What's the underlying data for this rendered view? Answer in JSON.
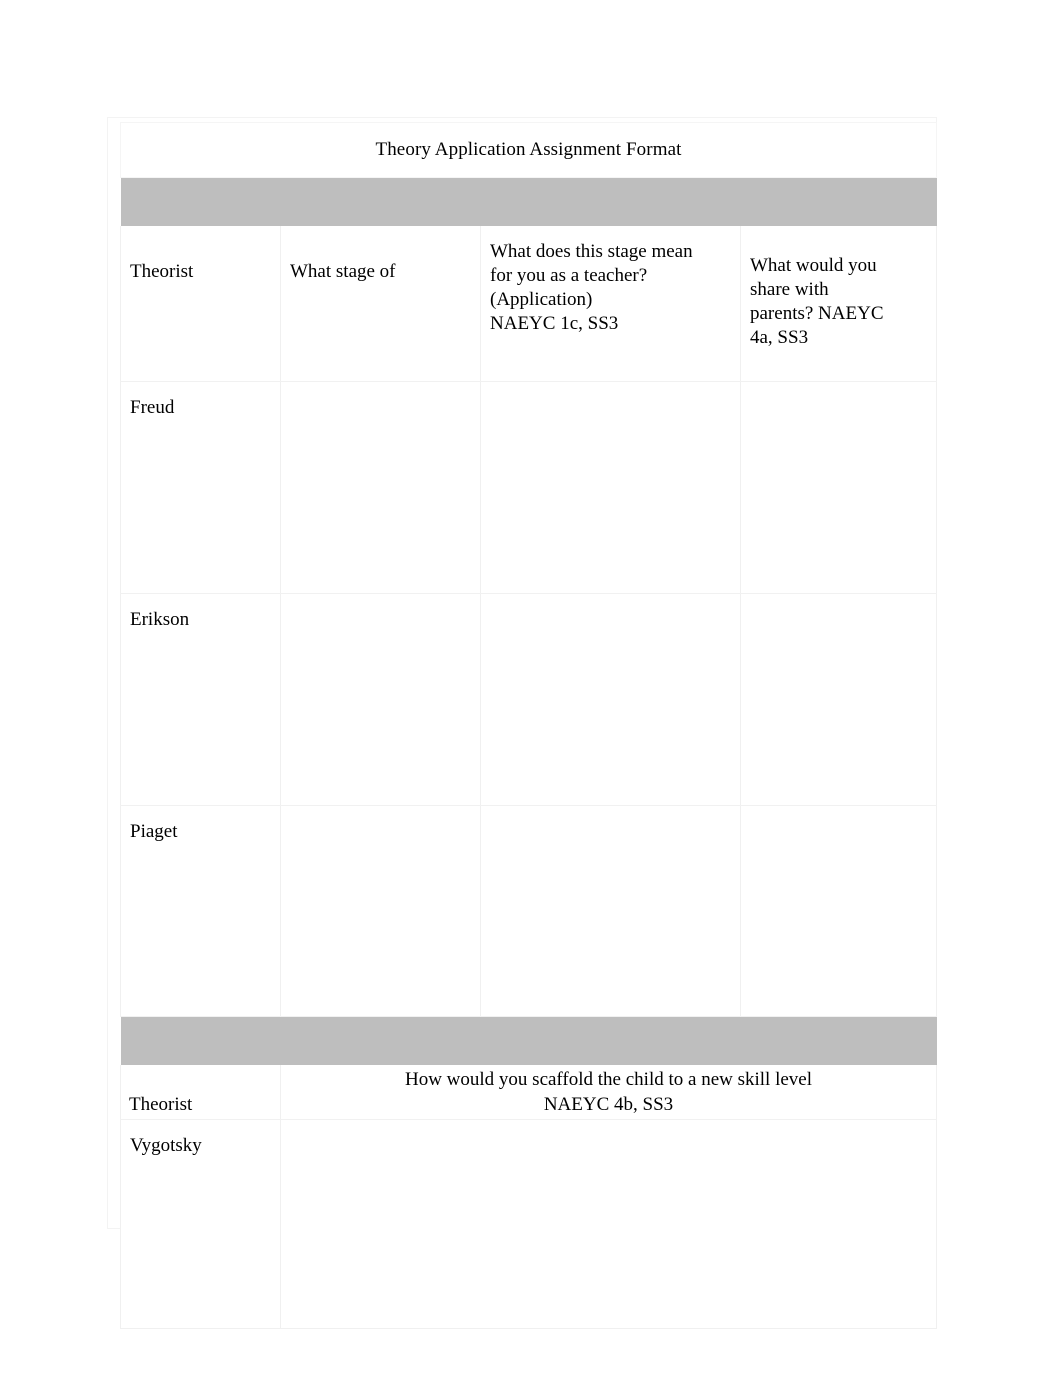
{
  "document": {
    "title": "Theory Application Assignment Format"
  },
  "section1": {
    "headers": {
      "theorist": "Theorist",
      "stage": "What stage of",
      "teacher_application": {
        "line1": "What does this stage mean",
        "line2": "for you as a teacher?",
        "line3": "(Application)",
        "line4": "NAEYC 1c, SS3"
      },
      "share_with_parents": {
        "line1": "What would you",
        "line2": "share with",
        "line3": "parents?  NAEYC",
        "line4": "4a, SS3"
      }
    },
    "rows": [
      {
        "theorist": "Freud",
        "stage": "",
        "teacher_application": "",
        "share_with_parents": ""
      },
      {
        "theorist": "Erikson",
        "stage": "",
        "teacher_application": "",
        "share_with_parents": ""
      },
      {
        "theorist": "Piaget",
        "stage": "",
        "teacher_application": "",
        "share_with_parents": ""
      }
    ]
  },
  "section2": {
    "headers": {
      "theorist": "Theorist",
      "scaffold": {
        "line1": "How would you scaffold the child to a new skill level",
        "line2": "NAEYC 4b, SS3"
      }
    },
    "rows": [
      {
        "theorist": "Vygotsky",
        "scaffold": ""
      }
    ]
  },
  "colors": {
    "page_background": "#ffffff",
    "band_gray": "#bebebe",
    "cell_border": "#f0f0f0",
    "text": "#000000"
  }
}
